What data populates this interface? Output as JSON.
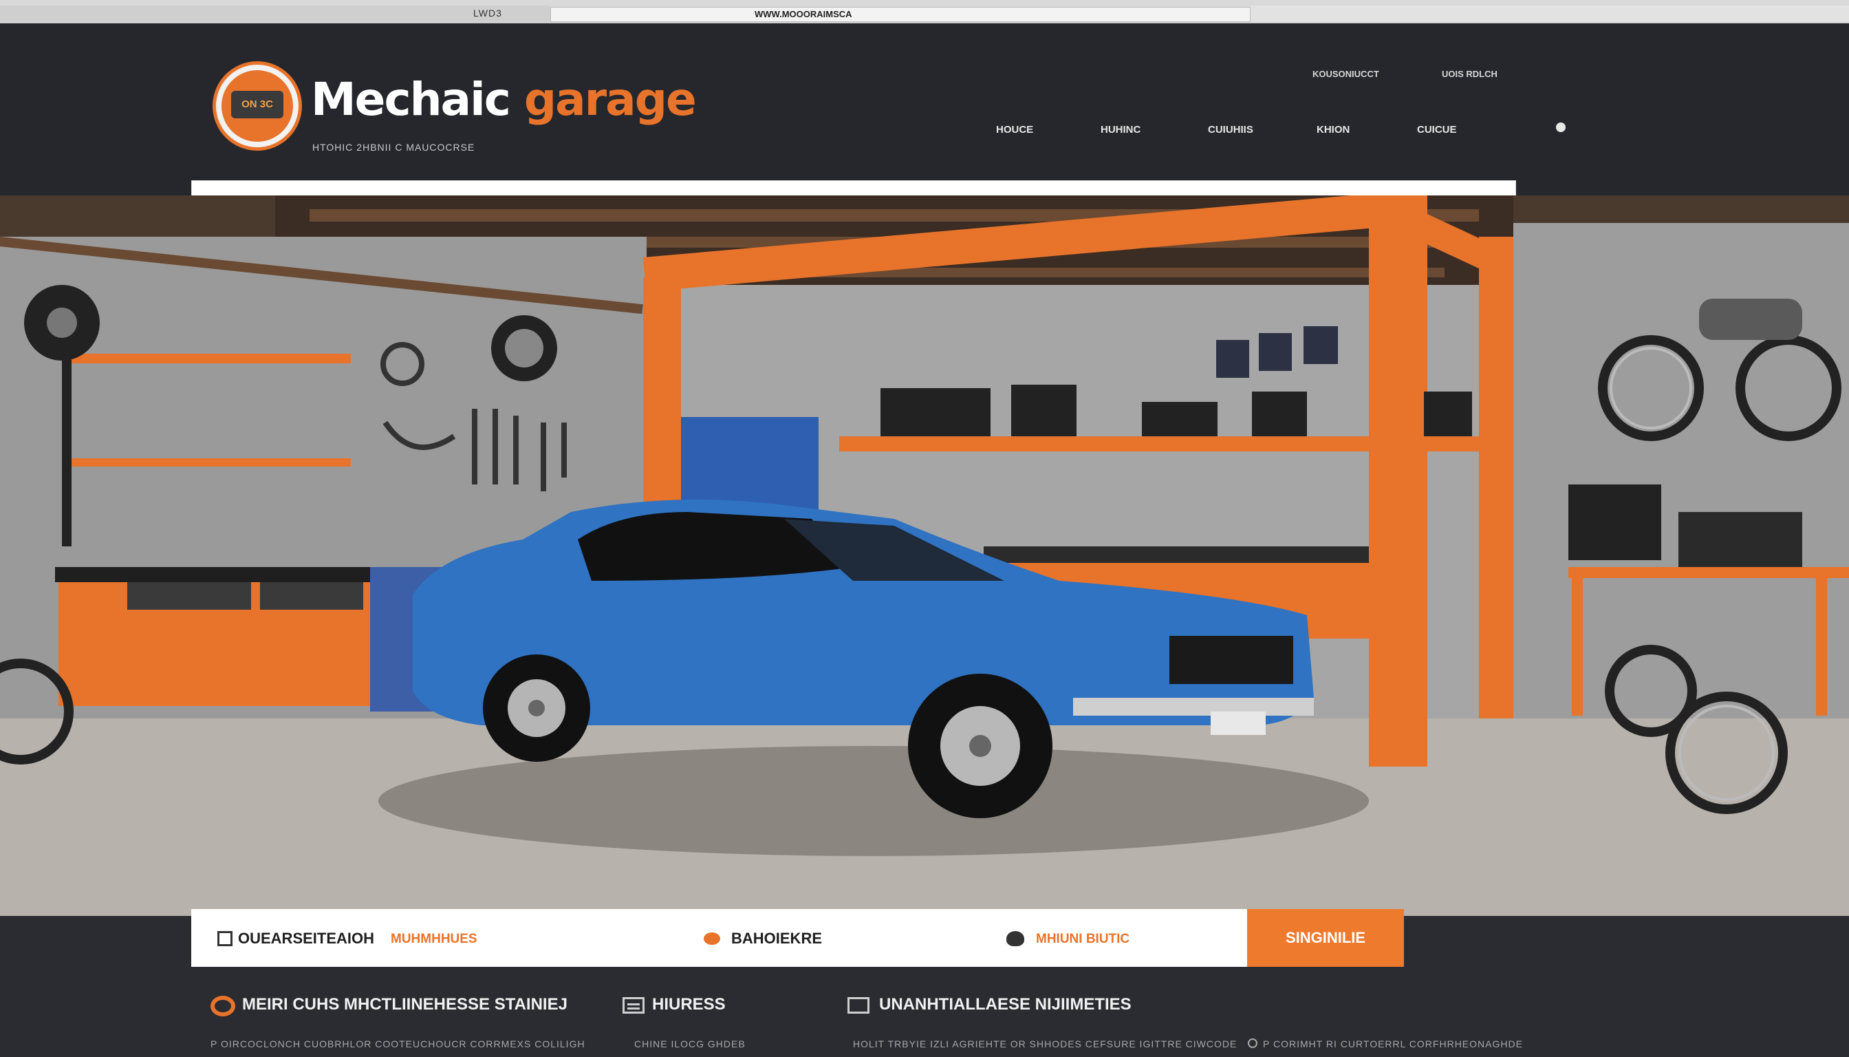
{
  "browser": {
    "tab_text": "LWD3",
    "url_text": "WWW.MOOORAIMSCA"
  },
  "brand": {
    "badge_text": "ON 3C",
    "name_part1": "Mechaic",
    "name_part2": "garage",
    "tagline": "HTOHIC 2HBNII C MAUCOCRSE",
    "accent_color": "#e8732a"
  },
  "header": {
    "utility_links": [
      "KOUSONIUCCT",
      "UOIS RDLCH"
    ],
    "nav": [
      "HOUCE",
      "HUHINC",
      "CUIUHIIS",
      "KHION",
      "CUICUE"
    ]
  },
  "info_bar": {
    "item1": "OUEARSEITEAIOH",
    "item1_sub": "MUHMHHUES",
    "item2": "BAHOIEKRE",
    "item3": "MHIUNI BIUTIC",
    "cta": "SINGINILIE"
  },
  "features": [
    {
      "title": "MEIRI CUHS MHCTLIINEHESSE STAINIEJ",
      "sub": "P OIRCOCLONCH CUOBRHLOR COOTEUCHOUCR CORRMEXS COLILIGH"
    },
    {
      "title": "HIURESS",
      "sub": "CHINE ILOCG GHDEB"
    },
    {
      "title": "UNANHTIALLAESE NIJIIMETIES",
      "sub": "HOLIT TRBYIE IZLI AGRIEHTE OR SHHODES CEFSURE IGITTRE CIWCODE"
    },
    {
      "title": "",
      "sub": "P CORIMHT RI CURTOERRL CORFHRHEONAGHDE"
    }
  ]
}
